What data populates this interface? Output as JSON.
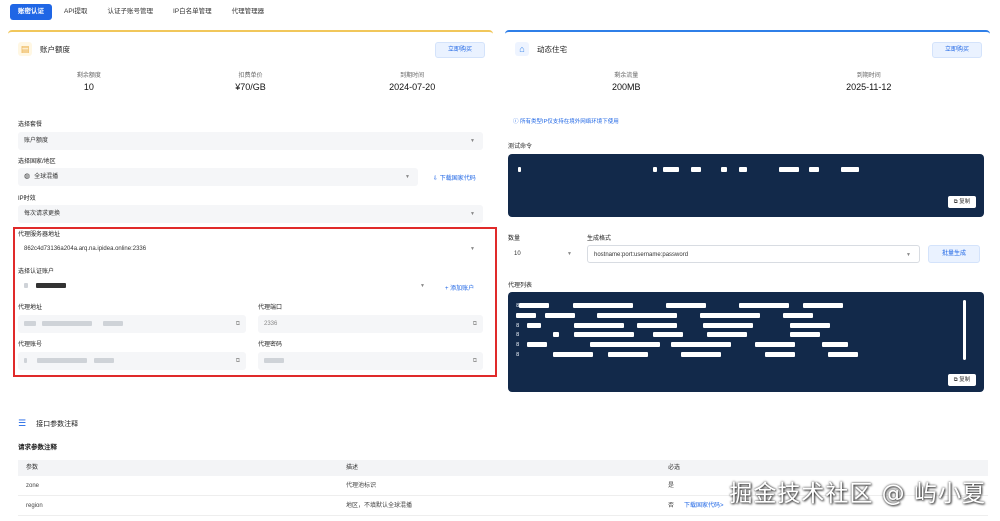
{
  "tabs": [
    "账密认证",
    "API提取",
    "认证子账号管理",
    "IP白名单管理",
    "代理管理器"
  ],
  "left": {
    "title": "账户额度",
    "buy": "立即购买",
    "stats": [
      {
        "label": "剩余额度",
        "value": "10"
      },
      {
        "label": "扣费单价",
        "value": "¥70/GB"
      },
      {
        "label": "到期时间",
        "value": "2024-07-20"
      }
    ],
    "plan_label": "选择套餐",
    "plan_value": "账户额度",
    "region_label": "选择国家/地区",
    "region_value": "全球混播",
    "download_code": "下载国家代码",
    "ip_label": "IP时效",
    "ip_value": "每次请求更换",
    "server_label": "代理服务器地址",
    "server_value": "862c4d73136a204a.arq.na.ipidea.online:2336",
    "auth_label": "选择认证账户",
    "add_account": "添加账户",
    "addr_label": "代理地址",
    "port_label": "代理端口",
    "port_value": "2336",
    "user_label": "代理账号",
    "pass_label": "代理密码"
  },
  "right": {
    "title": "动态住宅",
    "buy": "立即购买",
    "stats": [
      {
        "label": "剩余流量",
        "value": "200MB"
      },
      {
        "label": "到期时间",
        "value": "2025-11-12"
      }
    ],
    "tip": "所有类型IP仅支持在境外网络环境下使用",
    "test_label": "测试命令",
    "copy": "复制",
    "count_label": "数量",
    "count_value": "10",
    "format_label": "生成格式",
    "format_value": "hostname:port:username:password",
    "generate": "批量生成",
    "list_label": "代理列表"
  },
  "params": {
    "title": "接口参数注释",
    "sub": "请求参数注释",
    "headers": [
      "参数",
      "描述",
      "必选"
    ],
    "rows": [
      {
        "name": "zone",
        "desc": "代理池标识",
        "required": "是",
        "extra": ""
      },
      {
        "name": "region",
        "desc": "地区，不填默认全球混播",
        "required": "否",
        "extra": "下载国家代码>"
      }
    ]
  },
  "watermark": "掘金技术社区 @ 屿小夏"
}
